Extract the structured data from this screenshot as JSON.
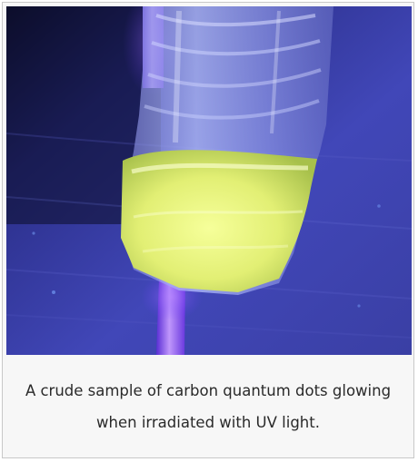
{
  "figure": {
    "image": {
      "subject": "water-bottle-glowing-under-uv",
      "colors": {
        "background_blue": "#3b40a8",
        "uv_purple": "#8a52ff",
        "glow_yellow": "#e9f27c"
      }
    },
    "caption": "A crude sample of carbon quantum dots glowing when irradiated with UV light."
  }
}
